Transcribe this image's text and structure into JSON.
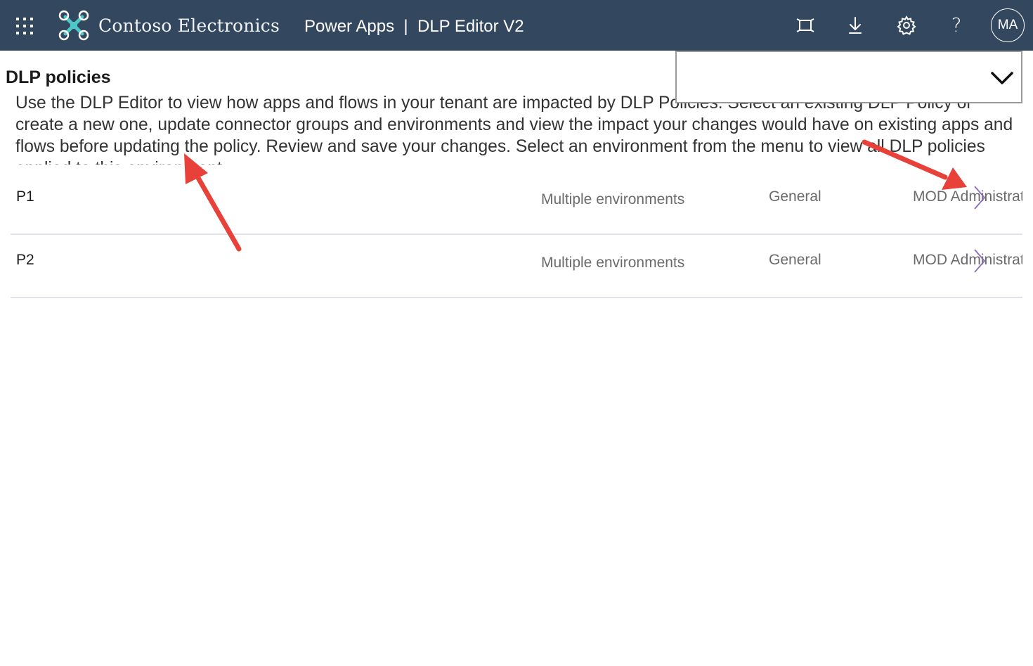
{
  "header": {
    "brand_name": "Contoso Electronics",
    "app_title": "Power Apps  |  DLP Editor V2",
    "icons": [
      "waffle-icon",
      "contoso-logo-icon",
      "fullscreen-icon",
      "download-icon",
      "settings-icon",
      "help-icon"
    ],
    "help_glyph": "?",
    "avatar_initials": "MA",
    "background_color": "#33475e"
  },
  "page": {
    "title": "DLP policies",
    "description": "Use the DLP Editor to view how apps and flows in your tenant are impacted by DLP Policies. Select an existing DLP Policy or create a new one, update connector groups and environments and view the impact your changes would have on existing apps and flows before updating the policy. Review and save your changes. Select an environment from the menu to view all DLP policies applied to this environment."
  },
  "environment_dropdown": {
    "selected_value": ""
  },
  "policies": [
    {
      "name": "P1",
      "environments": "Multiple environments",
      "type": "General",
      "created_by": "MOD Administrator"
    },
    {
      "name": "P2",
      "environments": "Multiple environments",
      "type": "General",
      "created_by": "MOD Administrator"
    }
  ],
  "colors": {
    "annotation_arrow": "#e8413a",
    "row_chevron": "#8a6bbf",
    "row_divider": "#e2e2ea"
  }
}
